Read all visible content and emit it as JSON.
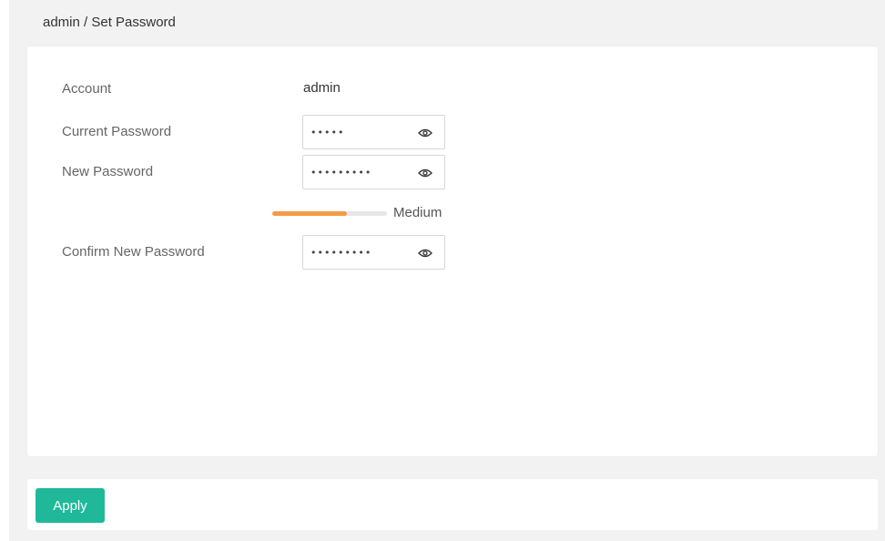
{
  "breadcrumb": "admin / Set Password",
  "form": {
    "account_label": "Account",
    "account_value": "admin",
    "current_password_label": "Current Password",
    "current_password_value": "•••••",
    "new_password_label": "New Password",
    "new_password_value": "•••••••••",
    "confirm_password_label": "Confirm New Password",
    "confirm_password_value": "•••••••••",
    "eye_icon": "eye-icon"
  },
  "strength": {
    "level_label": "Medium",
    "fraction": 0.65,
    "color": "#f49b47"
  },
  "footer": {
    "apply_label": "Apply"
  },
  "colors": {
    "accent": "#1fb99a",
    "background": "#f2f2f3"
  }
}
